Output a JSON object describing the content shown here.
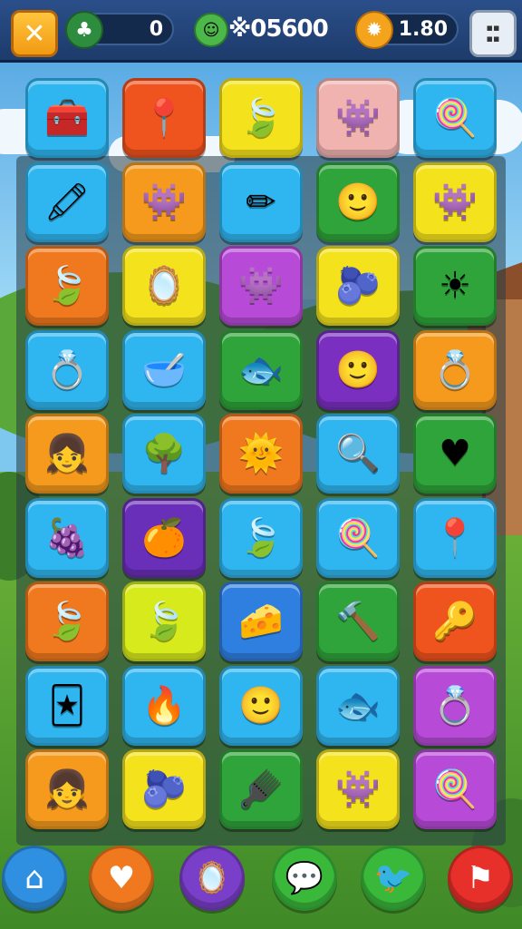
{
  "hud": {
    "close_icon": "close-icon",
    "lives": {
      "value": "0",
      "icon": "clover-icon"
    },
    "score": {
      "value": "※05600",
      "icon": "slime-icon"
    },
    "coins": {
      "value": "1.80",
      "icon": "sun-coin-icon"
    },
    "menu_icon": "menu-icon"
  },
  "board": {
    "columns": 5,
    "rows": [
      [
        {
          "icon": "chest-icon",
          "color": "#2fb6f0"
        },
        {
          "icon": "pin-icon",
          "color": "#f0541e"
        },
        {
          "icon": "leaf-icon",
          "color": "#f4e21c"
        },
        {
          "icon": "monster-icon",
          "color": "#f0b3b0"
        },
        {
          "icon": "lollipop-icon",
          "color": "#2fb6f0"
        }
      ],
      [
        {
          "icon": "crayon-icon",
          "color": "#2fb6f0"
        },
        {
          "icon": "monster-icon",
          "color": "#f59a1c"
        },
        {
          "icon": "pencil-icon",
          "color": "#2fb6f0"
        },
        {
          "icon": "face-icon",
          "color": "#2fa43a"
        },
        {
          "icon": "monster-icon",
          "color": "#f4e21c"
        }
      ],
      [
        {
          "icon": "leaf-icon",
          "color": "#f0781e"
        },
        {
          "icon": "mirror-icon",
          "color": "#f4e21c"
        },
        {
          "icon": "monster-icon",
          "color": "#b84ad8"
        },
        {
          "icon": "blob-icon",
          "color": "#f4e21c"
        },
        {
          "icon": "sun-icon",
          "color": "#2fa43a"
        }
      ],
      [
        {
          "icon": "ring-icon",
          "color": "#2fb6f0"
        },
        {
          "icon": "bowl-icon",
          "color": "#2fb6f0"
        },
        {
          "icon": "fish-icon",
          "color": "#2fa43a"
        },
        {
          "icon": "face-icon",
          "color": "#7a2fc0"
        },
        {
          "icon": "ring-icon",
          "color": "#f59a1c"
        }
      ],
      [
        {
          "icon": "girl-icon",
          "color": "#f59a1c"
        },
        {
          "icon": "bush-icon",
          "color": "#2fb6f0"
        },
        {
          "icon": "sun-face-icon",
          "color": "#f0781e"
        },
        {
          "icon": "magnifier-icon",
          "color": "#2fb6f0"
        },
        {
          "icon": "heart-icon",
          "color": "#2fa43a"
        }
      ],
      [
        {
          "icon": "berries-icon",
          "color": "#2fb6f0"
        },
        {
          "icon": "fruit-icon",
          "color": "#6a2fb8"
        },
        {
          "icon": "leaf-icon",
          "color": "#2fb6f0"
        },
        {
          "icon": "lollipop-icon",
          "color": "#2fb6f0"
        },
        {
          "icon": "pin-icon",
          "color": "#2fb6f0"
        }
      ],
      [
        {
          "icon": "leaf-icon",
          "color": "#f0781e"
        },
        {
          "icon": "leaf-icon",
          "color": "#d7ea1c"
        },
        {
          "icon": "cheese-icon",
          "color": "#2f7fe0"
        },
        {
          "icon": "hammer-icon",
          "color": "#2fa43a"
        },
        {
          "icon": "key-icon",
          "color": "#f0541e"
        }
      ],
      [
        {
          "icon": "card-icon",
          "color": "#2fb6f0"
        },
        {
          "icon": "matchstick-icon",
          "color": "#2fb6f0"
        },
        {
          "icon": "face-icon",
          "color": "#2fb6f0"
        },
        {
          "icon": "fish-icon",
          "color": "#2fb6f0"
        },
        {
          "icon": "ring-icon",
          "color": "#b84ad8"
        }
      ],
      [
        {
          "icon": "girl-icon",
          "color": "#f59a1c"
        },
        {
          "icon": "blob-icon",
          "color": "#f4e21c"
        },
        {
          "icon": "comb-icon",
          "color": "#2fa43a"
        },
        {
          "icon": "monster-icon",
          "color": "#f4e21c"
        },
        {
          "icon": "lollipop-icon",
          "color": "#b84ad8"
        }
      ]
    ]
  },
  "bottom_bar": [
    {
      "icon": "home-icon",
      "color": "#2f8fe0"
    },
    {
      "icon": "heart-icon",
      "color": "#f0781e"
    },
    {
      "icon": "mirror-icon",
      "color": "#7a3fc8"
    },
    {
      "icon": "chat-icon",
      "color": "#3ab83a"
    },
    {
      "icon": "bird-icon",
      "color": "#3ab83a"
    },
    {
      "icon": "flag-icon",
      "color": "#e8302a"
    }
  ]
}
